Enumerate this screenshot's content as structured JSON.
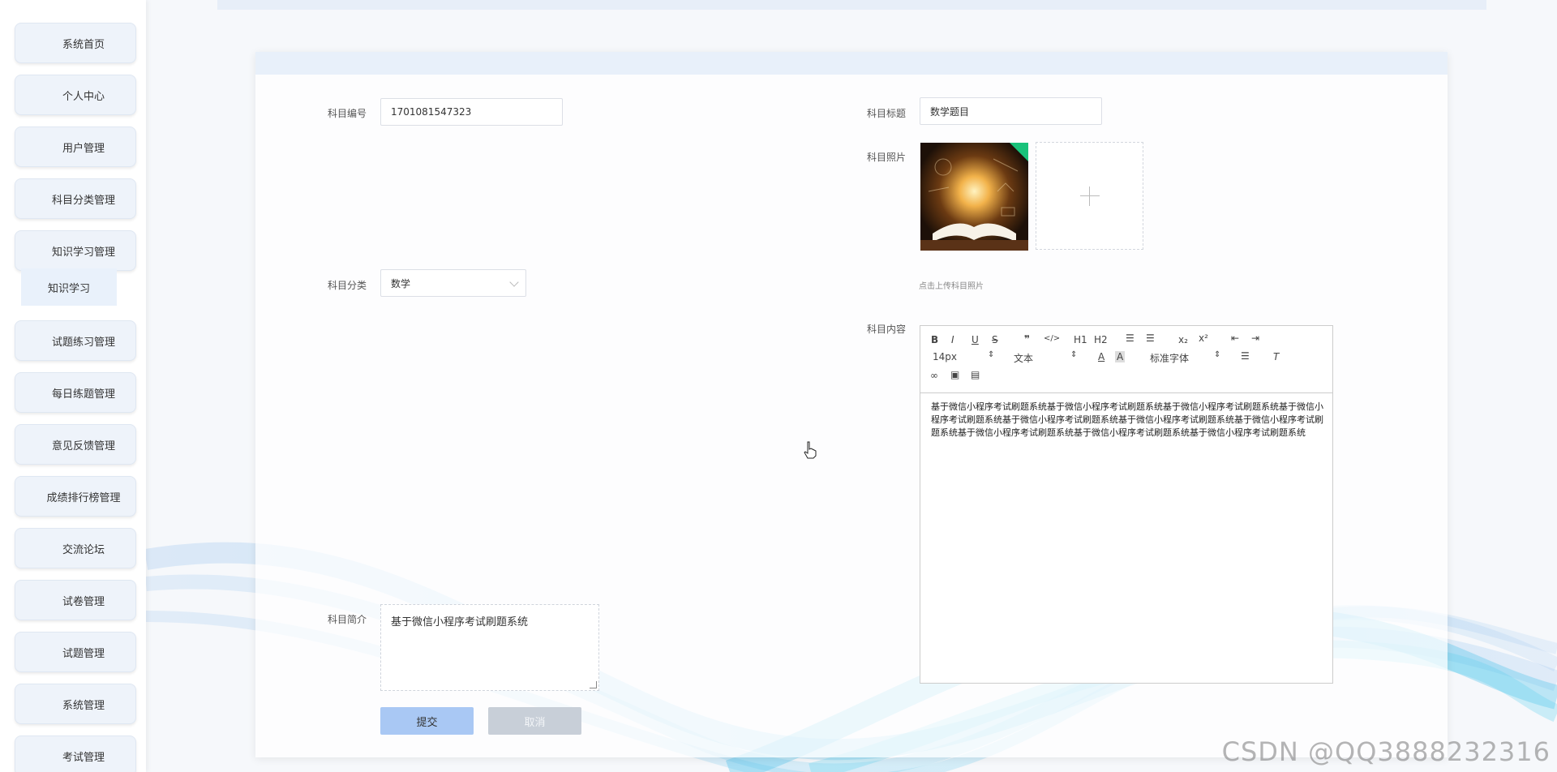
{
  "sidebar": {
    "items": [
      {
        "label": "系统首页"
      },
      {
        "label": "个人中心"
      },
      {
        "label": "用户管理"
      },
      {
        "label": "科目分类管理"
      },
      {
        "label": "知识学习管理"
      },
      {
        "label": "试题练习管理"
      },
      {
        "label": "每日练题管理"
      },
      {
        "label": "意见反馈管理"
      },
      {
        "label": "成绩排行榜管理"
      },
      {
        "label": "交流论坛"
      },
      {
        "label": "试卷管理"
      },
      {
        "label": "试题管理"
      },
      {
        "label": "系统管理"
      },
      {
        "label": "考试管理"
      }
    ],
    "sub_item": "知识学习"
  },
  "form": {
    "code_label": "科目编号",
    "code_value": "1701081547323",
    "title_label": "科目标题",
    "title_value": "数学题目",
    "photo_label": "科目照片",
    "photo_hint": "点击上传科目照片",
    "category_label": "科目分类",
    "category_value": "数学",
    "content_label": "科目内容",
    "content_text": "基于微信小程序考试刷题系统基于微信小程序考试刷题系统基于微信小程序考试刷题系统基于微信小程序考试刷题系统基于微信小程序考试刷题系统基于微信小程序考试刷题系统基于微信小程序考试刷题系统基于微信小程序考试刷题系统基于微信小程序考试刷题系统基于微信小程序考试刷题系统",
    "intro_label": "科目简介",
    "intro_value": "基于微信小程序考试刷题系统",
    "submit_label": "提交",
    "cancel_label": "取消"
  },
  "editor": {
    "font_size": "14px",
    "text_type": "文本",
    "font_family": "标准字体",
    "h1": "H1",
    "h2": "H2",
    "bold": "B",
    "italic": "I",
    "underline": "U",
    "strike": "S",
    "quote": "❞",
    "code": "</>",
    "sub": "x₂",
    "sup": "x²",
    "color": "A",
    "bg": "A"
  },
  "watermark": "CSDN @QQ3888232316",
  "colors": {
    "accent": "#a9c8f4",
    "sidebar_bg": "#eef3fa",
    "header_strip": "#e8f0fa"
  }
}
